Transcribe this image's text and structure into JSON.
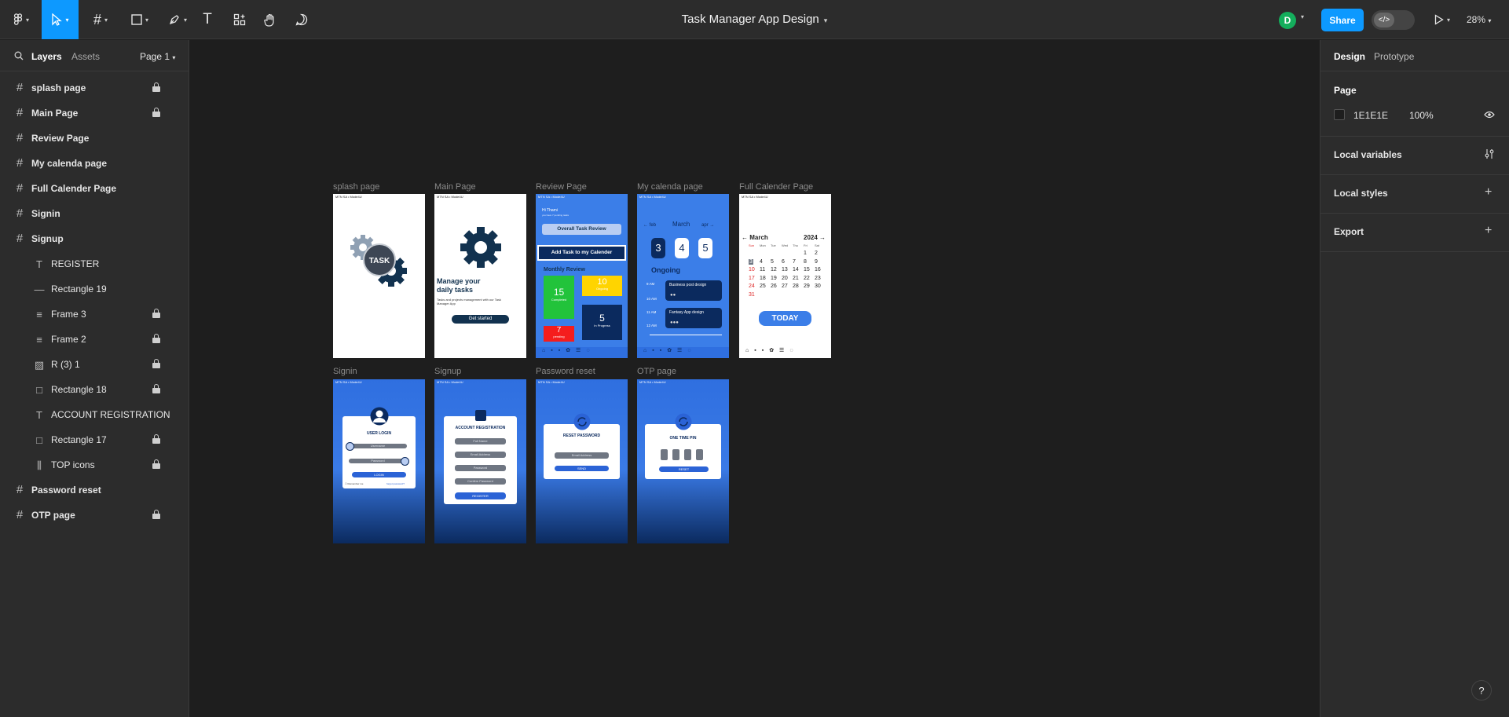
{
  "app": {
    "title": "Task Manager App Design",
    "zoom": "28%",
    "user_initial": "D",
    "share_label": "Share"
  },
  "toolbar": {
    "tools": [
      "figma-menu",
      "move",
      "frame",
      "shape",
      "pen",
      "text",
      "resources",
      "hand",
      "comment"
    ]
  },
  "left_panel": {
    "tabs": {
      "layers": "Layers",
      "assets": "Assets",
      "page": "Page 1"
    },
    "layers": [
      {
        "icon": "frame-icon",
        "label": "splash page",
        "locked": true,
        "indent": false
      },
      {
        "icon": "frame-icon",
        "label": "Main Page",
        "locked": true,
        "indent": false
      },
      {
        "icon": "frame-icon",
        "label": "Review Page",
        "locked": false,
        "indent": false
      },
      {
        "icon": "frame-icon",
        "label": "My calenda page",
        "locked": false,
        "indent": false
      },
      {
        "icon": "frame-icon",
        "label": "Full Calender Page",
        "locked": false,
        "indent": false
      },
      {
        "icon": "frame-icon",
        "label": "Signin",
        "locked": false,
        "indent": false
      },
      {
        "icon": "frame-icon",
        "label": "Signup",
        "locked": false,
        "indent": false
      },
      {
        "icon": "text-icon",
        "label": "REGISTER",
        "locked": false,
        "indent": true
      },
      {
        "icon": "line-icon",
        "label": "Rectangle 19",
        "locked": false,
        "indent": true
      },
      {
        "icon": "autolayout-icon",
        "label": "Frame 3",
        "locked": true,
        "indent": true
      },
      {
        "icon": "autolayout-icon",
        "label": "Frame 2",
        "locked": true,
        "indent": true
      },
      {
        "icon": "image-icon",
        "label": "R (3) 1",
        "locked": true,
        "indent": true
      },
      {
        "icon": "rectangle-icon",
        "label": "Rectangle 18",
        "locked": true,
        "indent": true
      },
      {
        "icon": "text-icon",
        "label": "ACCOUNT REGISTRATION",
        "locked": false,
        "indent": true
      },
      {
        "icon": "rectangle-icon",
        "label": "Rectangle 17",
        "locked": true,
        "indent": true
      },
      {
        "icon": "columns-icon",
        "label": "TOP icons",
        "locked": true,
        "indent": true
      },
      {
        "icon": "frame-icon",
        "label": "Password reset",
        "locked": false,
        "indent": false
      },
      {
        "icon": "frame-icon",
        "label": "OTP page",
        "locked": true,
        "indent": false
      }
    ]
  },
  "right_panel": {
    "tabs": {
      "design": "Design",
      "prototype": "Prototype"
    },
    "page_heading": "Page",
    "page_color": "1E1E1E",
    "page_opacity": "100%",
    "sections": {
      "local_variables": "Local variables",
      "local_styles": "Local styles",
      "export": "Export"
    },
    "swatch_color": "#1e1e1e"
  },
  "frames": {
    "splash": {
      "label": "splash page",
      "logo_text": "TASK"
    },
    "main": {
      "label": "Main Page",
      "heading": "Manage your daily tasks",
      "body": "Tasks and projects management with our Task Manager App",
      "button": "Get started"
    },
    "review": {
      "label": "Review Page",
      "greeting": "Hi Thami",
      "sub": "you have 7 pending tasks",
      "overall": "Overall Task Review",
      "add_task": "Add Task to my Calender",
      "monthly": "Monthly Review",
      "completed_num": "15",
      "completed_lbl": "Completed",
      "ongoing_num": "10",
      "ongoing_lbl": "Ongoing",
      "pending_num": "7",
      "pending_lbl": "pending",
      "progress_num": "5",
      "progress_lbl": "In Progress"
    },
    "mycal": {
      "label": "My calenda page",
      "month": "March",
      "prev": "feb",
      "next": "apr",
      "d1": "3",
      "d2": "4",
      "d3": "5",
      "ongoing": "Ongoing",
      "t1": "9 AM",
      "t2": "10 AM",
      "t3": "11 AM",
      "t4": "12 AM",
      "task1": "Business post design",
      "task2": "Fantasy App design"
    },
    "fullcal": {
      "label": "Full Calender Page",
      "month": "March",
      "year": "2024",
      "days": [
        "Sun",
        "Mon",
        "Tue",
        "Wed",
        "Thu",
        "Fri",
        "Sat"
      ],
      "today_btn": "TODAY",
      "rows": [
        [
          "",
          "",
          "",
          "",
          "",
          "1",
          "2"
        ],
        [
          "3",
          "4",
          "5",
          "6",
          "7",
          "8",
          "9"
        ],
        [
          "10",
          "11",
          "12",
          "13",
          "14",
          "15",
          "16"
        ],
        [
          "17",
          "18",
          "19",
          "20",
          "21",
          "22",
          "23"
        ],
        [
          "24",
          "25",
          "26",
          "27",
          "28",
          "29",
          "30"
        ],
        [
          "31",
          "",
          "",
          "",
          "",
          "",
          ""
        ]
      ]
    },
    "signin": {
      "label": "Signin",
      "title": "USER LOGIN",
      "username": "Username",
      "password": "Password",
      "button": "LOGIN",
      "remember": "Remember me",
      "forgot": "forgot password?"
    },
    "signup": {
      "label": "Signup",
      "title": "ACCOUNT REGISTRATION",
      "full_name": "Full Name",
      "email": "Email Address",
      "password": "Password",
      "confirm": "Confirm Password",
      "button": "REGISTER"
    },
    "reset": {
      "label": "Password reset",
      "title": "RESET PASSWORD",
      "email": "Email Address",
      "button": "SEND"
    },
    "otp": {
      "label": "OTP page",
      "title": "ONE TIME PIN",
      "button": "RESET"
    },
    "statusbar": "MTN SA • Mode4U"
  }
}
